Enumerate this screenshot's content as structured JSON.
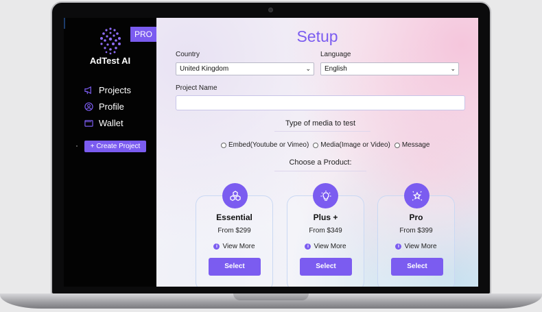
{
  "app": {
    "brand": "AdTest AI",
    "badge": "PRO"
  },
  "sidebar": {
    "items": [
      {
        "label": "Projects",
        "icon": "megaphone-icon"
      },
      {
        "label": "Profile",
        "icon": "user-circle-icon"
      },
      {
        "label": "Wallet",
        "icon": "wallet-icon"
      }
    ],
    "create_button": "+ Create Project"
  },
  "main": {
    "title": "Setup",
    "country": {
      "label": "Country",
      "value": "United Kingdom"
    },
    "language": {
      "label": "Language",
      "value": "English"
    },
    "project_name": {
      "label": "Project Name",
      "value": ""
    },
    "media_type": {
      "heading": "Type of media to test",
      "options": [
        "Embed(Youtube or Vimeo)",
        "Media(Image or Video)",
        "Message"
      ]
    },
    "product_heading": "Choose a Product:",
    "products": [
      {
        "name": "Essential",
        "price": "From $299",
        "more": "View More",
        "button": "Select",
        "icon": "cubes-icon"
      },
      {
        "name": "Plus +",
        "price": "From $349",
        "more": "View More",
        "button": "Select",
        "icon": "lightbulb-icon"
      },
      {
        "name": "Pro",
        "price": "From $399",
        "more": "View More",
        "button": "Select",
        "icon": "sparkle-star-icon"
      }
    ]
  },
  "colors": {
    "accent": "#7b5cf0",
    "sidebar_bg": "#030303"
  }
}
